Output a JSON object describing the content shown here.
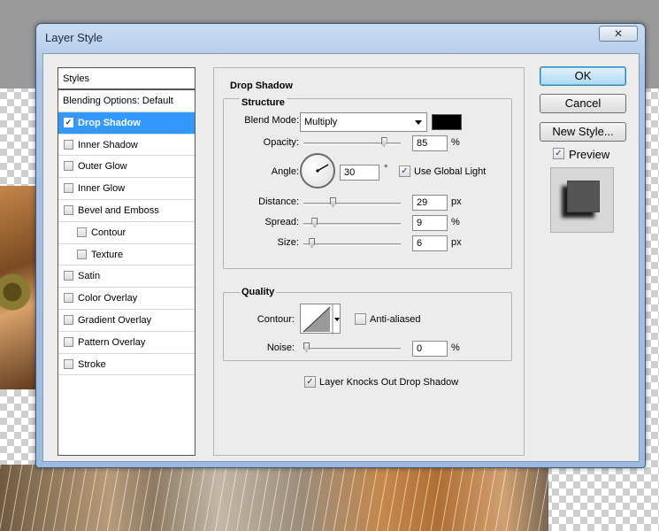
{
  "window": {
    "title": "Layer Style",
    "close_glyph": "✕"
  },
  "styles_list": {
    "header": "Styles",
    "items": [
      {
        "label": "Blending Options: Default",
        "checkbox": false,
        "checked": false,
        "indent": false,
        "selected": false
      },
      {
        "label": "Drop Shadow",
        "checkbox": true,
        "checked": true,
        "indent": false,
        "selected": true
      },
      {
        "label": "Inner Shadow",
        "checkbox": true,
        "checked": false,
        "indent": false,
        "selected": false
      },
      {
        "label": "Outer Glow",
        "checkbox": true,
        "checked": false,
        "indent": false,
        "selected": false
      },
      {
        "label": "Inner Glow",
        "checkbox": true,
        "checked": false,
        "indent": false,
        "selected": false
      },
      {
        "label": "Bevel and Emboss",
        "checkbox": true,
        "checked": false,
        "indent": false,
        "selected": false
      },
      {
        "label": "Contour",
        "checkbox": true,
        "checked": false,
        "indent": true,
        "selected": false
      },
      {
        "label": "Texture",
        "checkbox": true,
        "checked": false,
        "indent": true,
        "selected": false
      },
      {
        "label": "Satin",
        "checkbox": true,
        "checked": false,
        "indent": false,
        "selected": false
      },
      {
        "label": "Color Overlay",
        "checkbox": true,
        "checked": false,
        "indent": false,
        "selected": false
      },
      {
        "label": "Gradient Overlay",
        "checkbox": true,
        "checked": false,
        "indent": false,
        "selected": false
      },
      {
        "label": "Pattern Overlay",
        "checkbox": true,
        "checked": false,
        "indent": false,
        "selected": false
      },
      {
        "label": "Stroke",
        "checkbox": true,
        "checked": false,
        "indent": false,
        "selected": false
      }
    ]
  },
  "drop_shadow": {
    "title": "Drop Shadow",
    "structure": {
      "title": "Structure",
      "blend_mode_label": "Blend Mode:",
      "blend_mode_value": "Multiply",
      "shadow_color": "#000000",
      "opacity_label": "Opacity:",
      "opacity_value": "85",
      "opacity_unit": "%",
      "opacity_level": 0.85,
      "angle_label": "Angle:",
      "angle_value": "30",
      "angle_unit": "°",
      "angle_degrees": 30,
      "global_light_label": "Use Global Light",
      "global_light_checked": true,
      "distance_label": "Distance:",
      "distance_value": "29",
      "distance_unit": "px",
      "distance_level": 0.29,
      "spread_label": "Spread:",
      "spread_value": "9",
      "spread_unit": "%",
      "spread_level": 0.09,
      "size_label": "Size:",
      "size_value": "6",
      "size_unit": "px",
      "size_level": 0.06
    },
    "quality": {
      "title": "Quality",
      "contour_label": "Contour:",
      "anti_aliased_label": "Anti-aliased",
      "anti_aliased_checked": false,
      "noise_label": "Noise:",
      "noise_value": "0",
      "noise_unit": "%",
      "noise_level": 0
    },
    "knockout_label": "Layer Knocks Out Drop Shadow",
    "knockout_checked": true
  },
  "buttons": {
    "ok": "OK",
    "cancel": "Cancel",
    "new_style": "New Style...",
    "preview_label": "Preview",
    "preview_checked": true
  },
  "colors": {
    "selection": "#3399ff",
    "preview_bg": "#d7d7d7",
    "preview_square": "#555555"
  },
  "icons": {
    "check": "check-icon",
    "close": "close-icon",
    "dropdown": "chevron-down-icon",
    "angle_dial": "angle-dial-icon"
  }
}
